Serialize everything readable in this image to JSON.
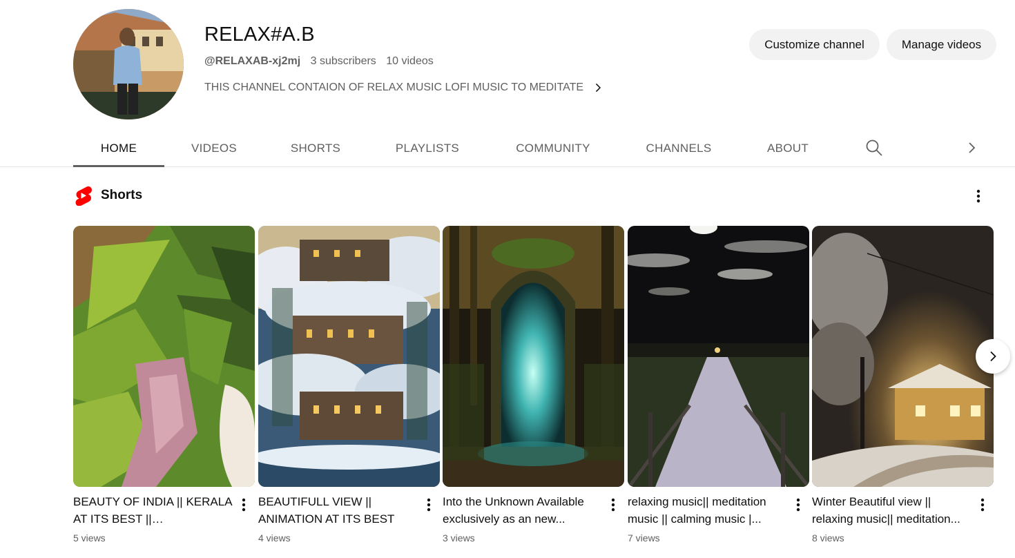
{
  "channel": {
    "title": "RELAX#A.B",
    "handle": "@RELAXAB-xj2mj",
    "subscribers": "3 subscribers",
    "videos": "10 videos",
    "description": "THIS CHANNEL CONTAION OF RELAX MUSIC LOFI MUSIC TO MEDITATE"
  },
  "actions": {
    "customize_label": "Customize channel",
    "manage_label": "Manage videos"
  },
  "tabs": [
    {
      "label": "HOME",
      "active": true
    },
    {
      "label": "VIDEOS",
      "active": false
    },
    {
      "label": "SHORTS",
      "active": false
    },
    {
      "label": "PLAYLISTS",
      "active": false
    },
    {
      "label": "COMMUNITY",
      "active": false
    },
    {
      "label": "CHANNELS",
      "active": false
    },
    {
      "label": "ABOUT",
      "active": false
    }
  ],
  "shorts": {
    "section_title": "Shorts",
    "brand_color": "#ff0000",
    "items": [
      {
        "title": "BEAUTY OF INDIA || KERALA AT ITS BEST || BEAUTIFULL...",
        "views": "5 views"
      },
      {
        "title": "BEAUTIFULL VIEW || ANIMATION AT ITS BEST",
        "views": "4 views"
      },
      {
        "title": "Into the Unknown Available exclusively as an new...",
        "views": "3 views"
      },
      {
        "title": "relaxing music|| meditation music || calming music |...",
        "views": "7 views"
      },
      {
        "title": "Winter Beautiful view || relaxing music|| meditation...",
        "views": "8 views"
      }
    ]
  },
  "icons": {
    "description_more": "chevron-right-icon",
    "tab_search": "search-icon",
    "tab_scroll": "chevron-right-icon",
    "section_menu": "more-vertical-icon",
    "carousel_next": "chevron-right-icon"
  }
}
